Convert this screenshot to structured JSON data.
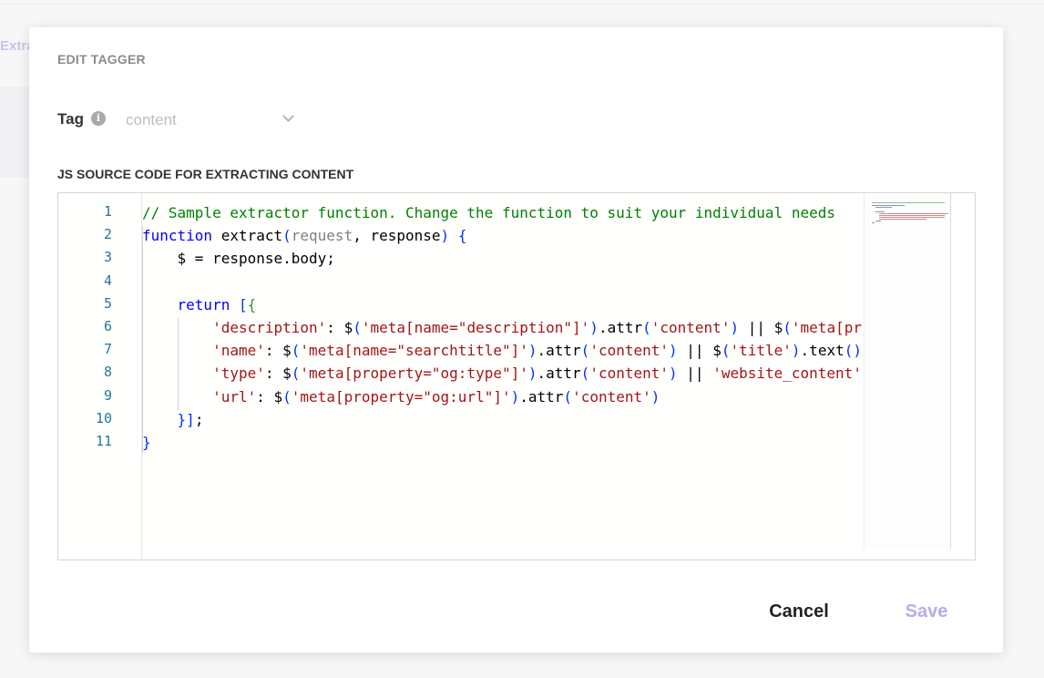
{
  "background": {
    "fragment_text": "Extra"
  },
  "modal": {
    "title": "EDIT TAGGER",
    "tag_label": "Tag",
    "tag_info_icon": "info-icon",
    "tag_value": "content",
    "code_label": "JS SOURCE CODE FOR EXTRACTING CONTENT",
    "cancel_label": "Cancel",
    "save_label": "Save"
  },
  "editor": {
    "line_numbers": [
      "1",
      "2",
      "3",
      "4",
      "5",
      "6",
      "7",
      "8",
      "9",
      "10",
      "11"
    ],
    "lines": [
      "// Sample extractor function. Change the function to suit your individual needs",
      "function extract(request, response) {",
      "    $ = response.body;",
      "",
      "    return [{",
      "        'description': $('meta[name=\"description\"]').attr('content') || $('meta[pr",
      "        'name': $('meta[name=\"searchtitle\"]').attr('content') || $('title').text()",
      "        'type': $('meta[property=\"og:type\"]').attr('content') || 'website_content'",
      "        'url': $('meta[property=\"og:url\"]').attr('content')",
      "    }];",
      "}"
    ]
  },
  "colors": {
    "accent": "#b3aee8",
    "comment": "#008000",
    "keyword": "#0000ff",
    "string": "#a31515",
    "line_number": "#237893"
  }
}
